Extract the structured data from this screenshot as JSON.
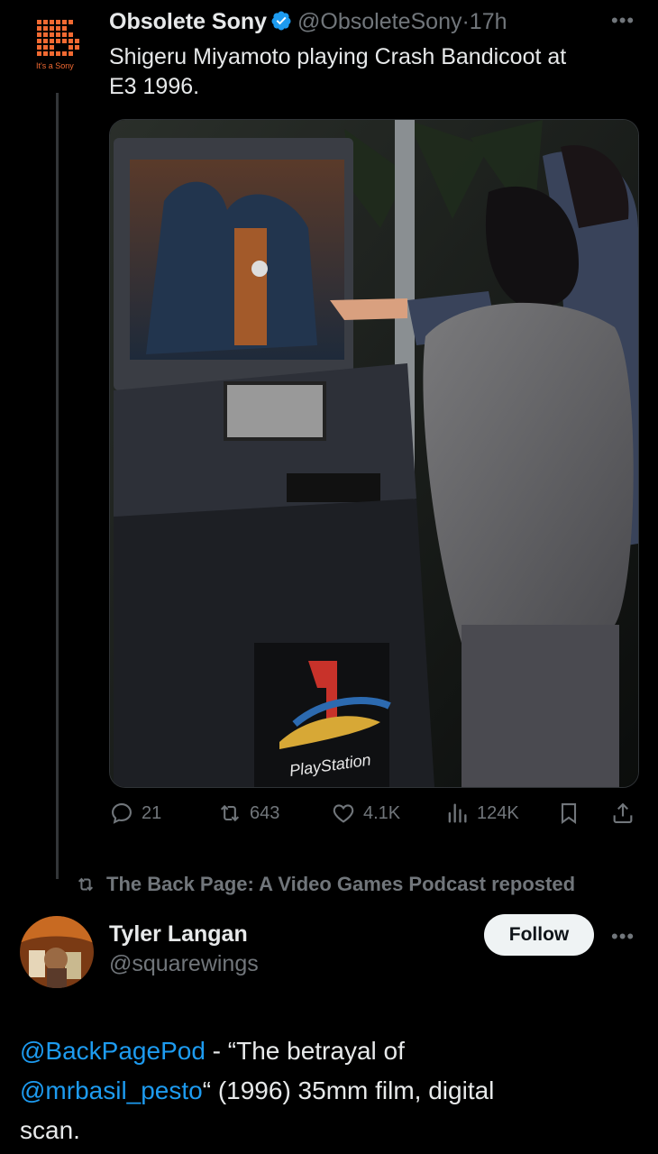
{
  "post1": {
    "author_name": "Obsolete Sony",
    "handle": "@ObsoleteSony",
    "separator": "·",
    "timestamp": "17h",
    "avatar_tagline": "It's a Sony",
    "text_line1": "Shigeru Miyamoto playing Crash Bandicoot at",
    "text_line2": "E3 1996.",
    "media_logo_text": "PlayStation",
    "stats": {
      "replies": "21",
      "reposts": "643",
      "likes": "4.1K",
      "views": "124K"
    }
  },
  "repost_note": "The Back Page: A Video Games Podcast reposted",
  "post2": {
    "author_name": "Tyler Langan",
    "handle": "@squarewings",
    "follow_label": "Follow",
    "mention1": "@BackPagePod",
    "text_part1": " - “The betrayal of",
    "mention2": "@mrbasil_pesto",
    "text_part2": "“  (1996) 35mm film, digital",
    "text_part3": "scan."
  },
  "icons": [
    "verified-badge-icon",
    "more-icon",
    "reply-icon",
    "repost-icon",
    "like-icon",
    "views-icon",
    "bookmark-icon",
    "share-icon"
  ],
  "colors": {
    "background": "#000000",
    "text": "#e7e9ea",
    "muted": "#71767b",
    "link": "#1d9bf0",
    "verified": "#1d9bf0",
    "sony_orange": "#f26a32"
  }
}
